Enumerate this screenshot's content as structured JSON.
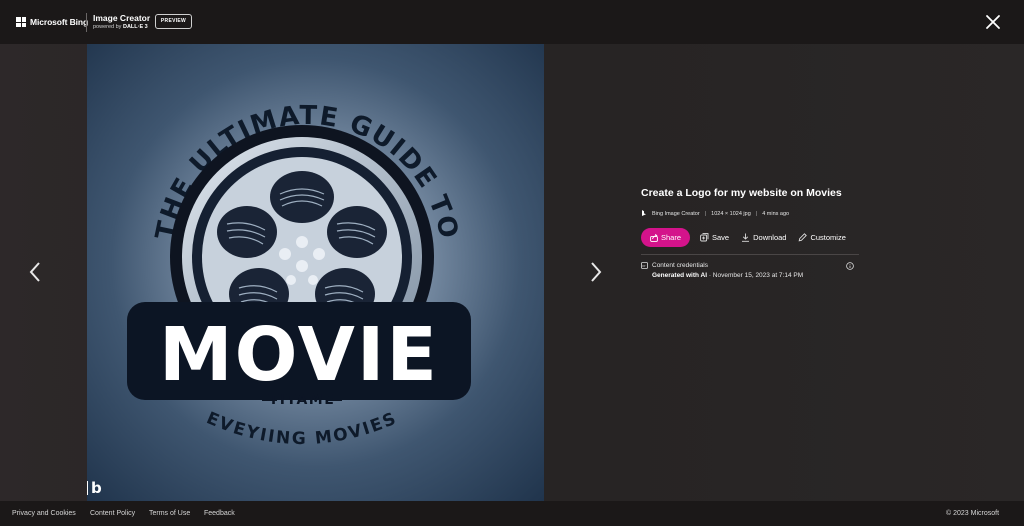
{
  "header": {
    "brand": "Microsoft Bing",
    "app_title": "Image Creator",
    "powered_by_prefix": "powered by ",
    "powered_by_name": "DALL·E 3",
    "badge": "PREVIEW"
  },
  "image": {
    "arc_text": "THE ULTIMATE GUIDE TO",
    "main_word": "MOVIE",
    "sub_word": "TITAME",
    "bottom_text": "EVEYIING MOVIES",
    "watermark": "b"
  },
  "details": {
    "title": "Create a Logo for my website on Movies",
    "meta": {
      "source": "Bing Image Creator",
      "size": "1024 × 1024 jpg",
      "time": "4 mins ago"
    },
    "actions": {
      "share": "Share",
      "save": "Save",
      "download": "Download",
      "customize": "Customize"
    },
    "credentials": {
      "label": "Content credentials",
      "generated": "Generated with AI",
      "date": " · November 15, 2023 at 7:14 PM"
    }
  },
  "footer": {
    "links": [
      "Privacy and Cookies",
      "Content Policy",
      "Terms of Use",
      "Feedback"
    ],
    "copyright": "© 2023 Microsoft"
  },
  "colors": {
    "accent": "#d4138b",
    "background": "#1a1717",
    "header": "#1b1818"
  }
}
